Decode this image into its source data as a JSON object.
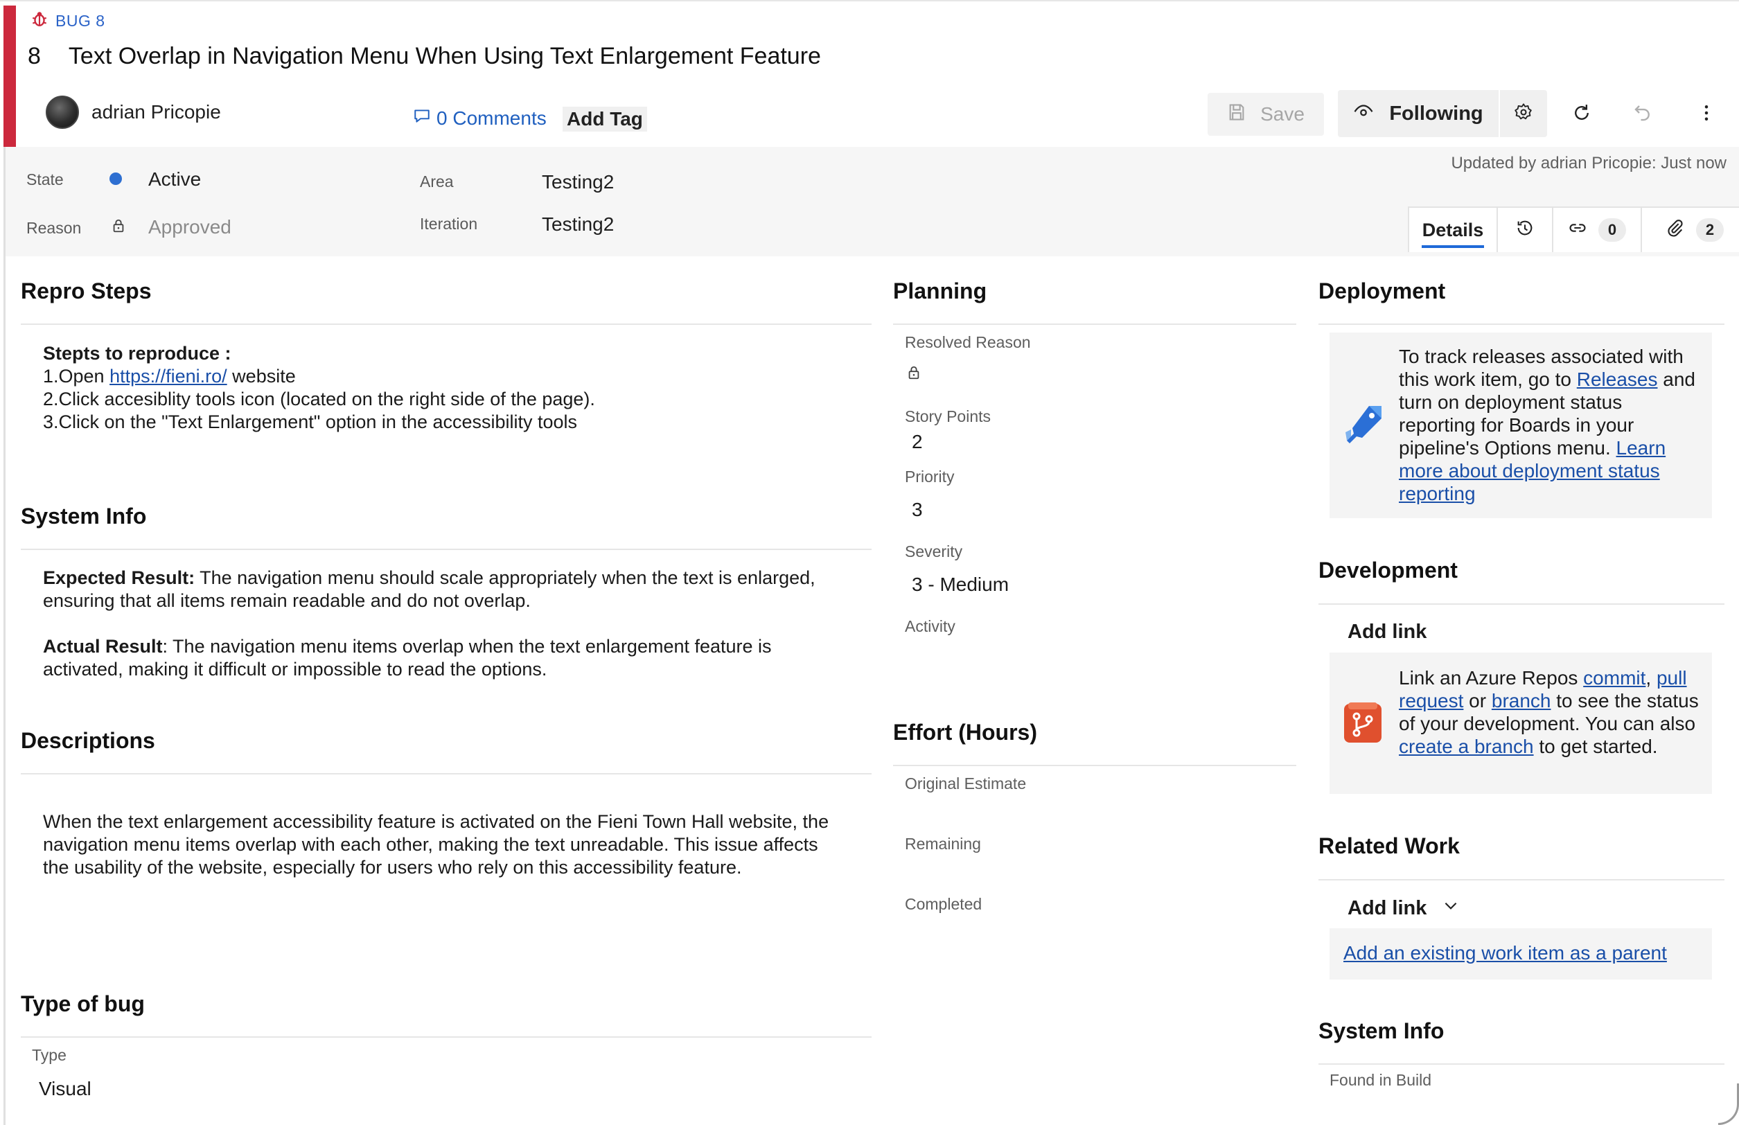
{
  "header": {
    "bug_tag": "BUG 8",
    "id": "8",
    "title": "Text Overlap in Navigation Menu When Using Text Enlargement Feature",
    "user": "adrian Pricopie",
    "comments": "0 Comments",
    "add_tag": "Add Tag"
  },
  "toolbar": {
    "save": "Save",
    "following": "Following"
  },
  "fields": {
    "state_label": "State",
    "state_value": "Active",
    "reason_label": "Reason",
    "reason_value": "Approved",
    "area_label": "Area",
    "area_value": "Testing2",
    "iteration_label": "Iteration",
    "iteration_value": "Testing2",
    "updated": "Updated by adrian Pricopie: Just now",
    "state_color": "#2e6fd1"
  },
  "tabs": {
    "details": "Details",
    "links_count": "0",
    "attachments_count": "2"
  },
  "repro": {
    "title": "Repro Steps",
    "heading": "Stepts to reproduce :",
    "step1_prefix": "1.Open ",
    "step1_link": "https://fieni.ro/",
    "step1_suffix": " website",
    "step2": "2.Click accesiblity tools icon (located on the right side of the page).",
    "step3": "3.Click on the \"Text Enlargement\" option in the accessibility tools"
  },
  "system_info": {
    "title": "System Info",
    "expected_label": "Expected Result:",
    "expected_text": " The navigation menu should scale appropriately when the text is enlarged, ensuring that all items remain readable and do not overlap.",
    "actual_label": "Actual Result",
    "actual_text": ": The navigation menu items overlap when the text enlargement feature is activated, making it difficult or impossible to read the options."
  },
  "descriptions": {
    "title": "Descriptions",
    "text": "When the text enlargement accessibility feature is activated on the Fieni Town Hall website, the navigation menu items overlap with each other, making the text unreadable. This issue affects the usability of the website, especially for users who rely on this accessibility feature."
  },
  "type_of_bug": {
    "title": "Type of bug",
    "type_label": "Type",
    "type_value": "Visual"
  },
  "planning": {
    "title": "Planning",
    "resolved_reason_label": "Resolved Reason",
    "story_points_label": "Story Points",
    "story_points_value": "2",
    "priority_label": "Priority",
    "priority_value": "3",
    "severity_label": "Severity",
    "severity_value": "3 - Medium",
    "activity_label": "Activity"
  },
  "effort": {
    "title": "Effort (Hours)",
    "original_label": "Original Estimate",
    "remaining_label": "Remaining",
    "completed_label": "Completed"
  },
  "deployment": {
    "title": "Deployment",
    "text1": "To track releases associated with this work item, go to ",
    "link1": "Releases",
    "text2": " and turn on deployment status reporting for Boards in your pipeline's Options menu. ",
    "link2": "Learn more about deployment status reporting"
  },
  "development": {
    "title": "Development",
    "add_link": "Add link",
    "text1": "Link an Azure Repos ",
    "link_commit": "commit",
    "comma": ", ",
    "link_pull": "pull request",
    "or": " or ",
    "link_branch": "branch",
    "text2": " to see the status of your development. You can also ",
    "link_create": "create a branch",
    "text3": " to get started."
  },
  "related_work": {
    "title": "Related Work",
    "add_link": "Add link",
    "add_parent": "Add an existing work item as a parent"
  },
  "system_info_right": {
    "title": "System Info",
    "found_in_build": "Found in Build"
  }
}
